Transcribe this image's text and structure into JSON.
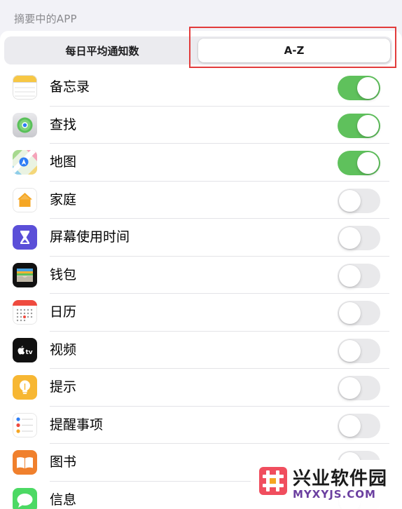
{
  "section_header": "摘要中的APP",
  "segmented_control": {
    "options": [
      "每日平均通知数",
      "A-Z"
    ],
    "selected_index": 1
  },
  "highlight_color": "#e23b3b",
  "toggle_on_color": "#5fc15c",
  "apps": [
    {
      "label": "备忘录",
      "icon": "notes-icon",
      "enabled": true
    },
    {
      "label": "查找",
      "icon": "find-my-icon",
      "enabled": true
    },
    {
      "label": "地图",
      "icon": "maps-icon",
      "enabled": true
    },
    {
      "label": "家庭",
      "icon": "home-icon",
      "enabled": false
    },
    {
      "label": "屏幕使用时间",
      "icon": "screen-time-icon",
      "enabled": false
    },
    {
      "label": "钱包",
      "icon": "wallet-icon",
      "enabled": false
    },
    {
      "label": "日历",
      "icon": "calendar-icon",
      "enabled": false
    },
    {
      "label": "视频",
      "icon": "apple-tv-icon",
      "enabled": false
    },
    {
      "label": "提示",
      "icon": "tips-icon",
      "enabled": false
    },
    {
      "label": "提醒事项",
      "icon": "reminders-icon",
      "enabled": false
    },
    {
      "label": "图书",
      "icon": "books-icon",
      "enabled": false
    },
    {
      "label": "信息",
      "icon": "messages-icon",
      "enabled": false
    }
  ],
  "watermark": {
    "name": "兴业软件园",
    "url": "MYXYJS.COM"
  }
}
